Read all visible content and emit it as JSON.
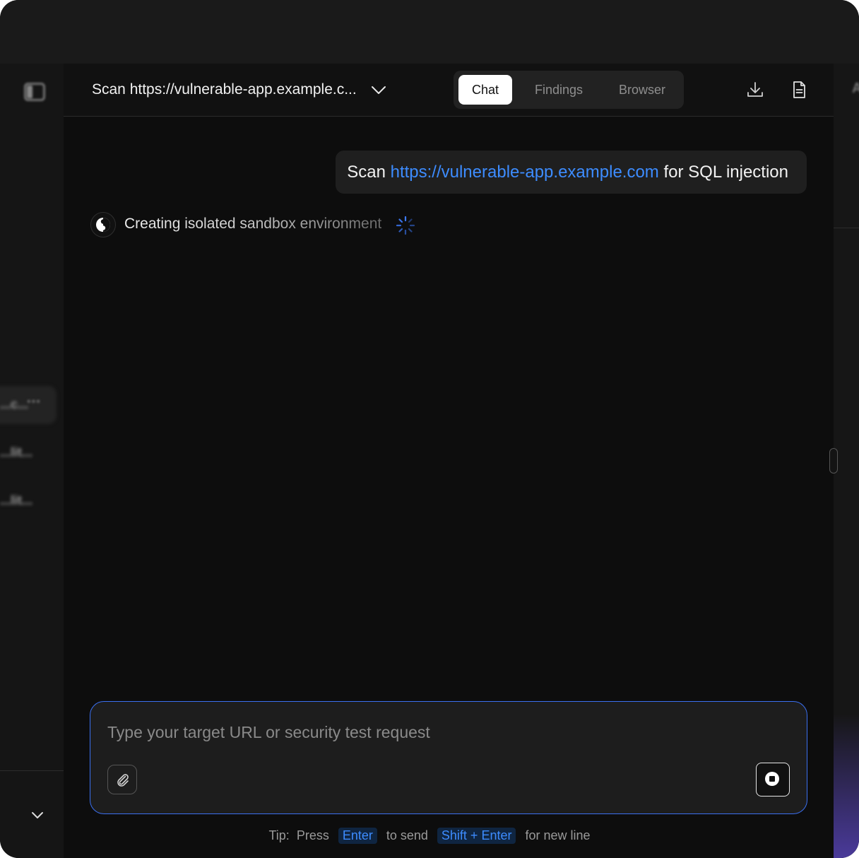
{
  "header": {
    "title": "Scan https://vulnerable-app.example.c...",
    "tabs": [
      {
        "label": "Chat",
        "active": true
      },
      {
        "label": "Findings",
        "active": false
      },
      {
        "label": "Browser",
        "active": false
      }
    ]
  },
  "sidebar": {
    "items": [
      {
        "label": "...c...",
        "active": true
      },
      {
        "label": "...lit...",
        "active": false
      },
      {
        "label": "...lit...",
        "active": false
      }
    ],
    "more_label": "•••"
  },
  "right_panel": {
    "glyph": "A"
  },
  "chat": {
    "user_message": {
      "prefix": "Scan ",
      "link": "https://vulnerable-app.example.com",
      "suffix": " for SQL injection"
    },
    "agent_status": "Creating isolated sandbox environment"
  },
  "composer": {
    "placeholder": "Type your target URL or security test request",
    "value": ""
  },
  "tip": {
    "label": "Tip:",
    "press": "Press",
    "key_send": "Enter",
    "send_text": "to send",
    "key_newline": "Shift + Enter",
    "newline_text": "for new line"
  },
  "colors": {
    "accent": "#3d8cff",
    "background": "#0d0d0d",
    "panel": "#1f1f1f",
    "border_focus": "#3a6ff0"
  },
  "icons": [
    "sidebar-toggle-icon",
    "chevron-down-icon",
    "download-icon",
    "document-icon",
    "paperclip-icon",
    "stop-icon",
    "spinner-icon",
    "agent-logo-icon"
  ]
}
